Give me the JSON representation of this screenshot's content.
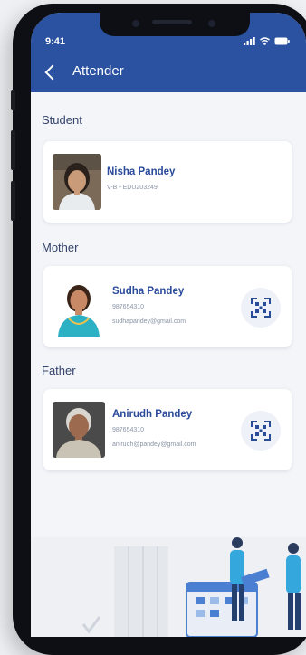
{
  "status": {
    "time": "9:41"
  },
  "header": {
    "title": "Attender"
  },
  "student": {
    "section": "Student",
    "name": "Nisha Pandey",
    "detail": "V-B  •  EDU203249"
  },
  "mother": {
    "section": "Mother",
    "name": "Sudha Pandey",
    "phone": "987654310",
    "email": "sudhapandey@gmail.com"
  },
  "father": {
    "section": "Father",
    "name": "Anirudh Pandey",
    "phone": "987654310",
    "email": "anirudh@pandey@gmail.com"
  },
  "icons": [
    "back-arrow-icon",
    "signal-icon",
    "wifi-icon",
    "battery-icon",
    "qr-code-icon"
  ],
  "colors": {
    "header": "#2a52a0",
    "name_text": "#2a4a9a",
    "background": "#f4f5f9"
  }
}
